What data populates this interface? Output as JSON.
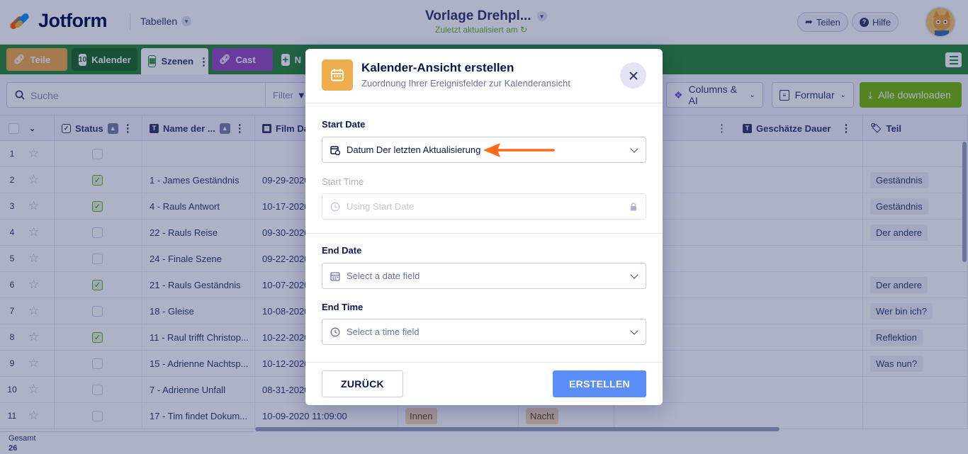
{
  "header": {
    "logo_text": "Jotform",
    "tables_label": "Tabellen",
    "doc_title": "Vorlage Drehpl...",
    "doc_subtitle": "Zuletzt aktualisiert am",
    "share_label": "Teilen",
    "help_label": "Hilfe"
  },
  "tabs": [
    {
      "label": "Teile",
      "color": "#f0ad4e"
    },
    {
      "label": "Kalender",
      "color": "#1f6e2a"
    },
    {
      "label": "Szenen",
      "color": "#ffffff"
    },
    {
      "label": "Cast",
      "color": "#9c4dc2"
    },
    {
      "label": "N"
    }
  ],
  "toolbar": {
    "search_placeholder": "Suche",
    "filter_label": "Filter",
    "columns_label": "Columns & AI",
    "form_label": "Formular",
    "download_label": "Alle downloaden"
  },
  "grid": {
    "columns": [
      "Status",
      "Name der ...",
      "Film Da",
      "Geschätze Dauer",
      "Teil"
    ],
    "rows": [
      {
        "num": "1",
        "checked": false,
        "name": "",
        "date": "",
        "teil": ""
      },
      {
        "num": "2",
        "checked": true,
        "name": "1 - James Geständnis",
        "date": "09-29-2020",
        "teil": "Geständnis"
      },
      {
        "num": "3",
        "checked": true,
        "name": "4 - Rauls Antwort",
        "date": "10-17-2020",
        "teil": "Geständnis"
      },
      {
        "num": "4",
        "checked": false,
        "name": "22 - Rauls Reise",
        "date": "09-30-2020",
        "teil": "Der andere"
      },
      {
        "num": "5",
        "checked": false,
        "name": "24 - Finale Szene",
        "date": "09-22-2020",
        "teil": ""
      },
      {
        "num": "6",
        "checked": true,
        "name": "21 - Rauls Geständnis",
        "date": "10-07-2020",
        "teil": "Der andere"
      },
      {
        "num": "7",
        "checked": false,
        "name": "18 - Gleise",
        "date": "10-08-2020",
        "teil": "Wer bin ich?"
      },
      {
        "num": "8",
        "checked": true,
        "name": "11 - Raul trifft Christop...",
        "date": "10-22-2020",
        "teil": "Reflektion"
      },
      {
        "num": "9",
        "checked": false,
        "name": "15 - Adrienne Nachtsp...",
        "date": "10-12-2020",
        "teil": "Was nun?"
      },
      {
        "num": "10",
        "checked": false,
        "name": "7 - Adrienne Unfall",
        "date": "08-31-2020",
        "teil": ""
      },
      {
        "num": "11",
        "checked": false,
        "name": "17 - Tim findet Dokum...",
        "date": "10-09-2020 11:09:00",
        "teil": "",
        "location": "Innen",
        "daytime": "Nacht"
      }
    ],
    "footer_label": "Gesamt",
    "footer_count": "26"
  },
  "modal": {
    "title": "Kalender-Ansicht erstellen",
    "subtitle": "Zuordnung Ihrer Ereignisfelder zur Kalenderansicht",
    "start_date_label": "Start Date",
    "start_date_value": "Datum Der letzten Aktualisierung",
    "start_time_label": "Start Time",
    "start_time_placeholder": "Using Start Date",
    "end_date_label": "End Date",
    "end_date_placeholder": "Select a date field",
    "end_time_label": "End Time",
    "end_time_placeholder": "Select a time field",
    "back_label": "ZURÜCK",
    "create_label": "ERSTELLEN"
  },
  "colors": {
    "tabbar": "#2e8b3a",
    "accent_orange": "#f0ad4e",
    "create_button": "#5b8ef6",
    "annotation_arrow": "#ff6a1a"
  }
}
